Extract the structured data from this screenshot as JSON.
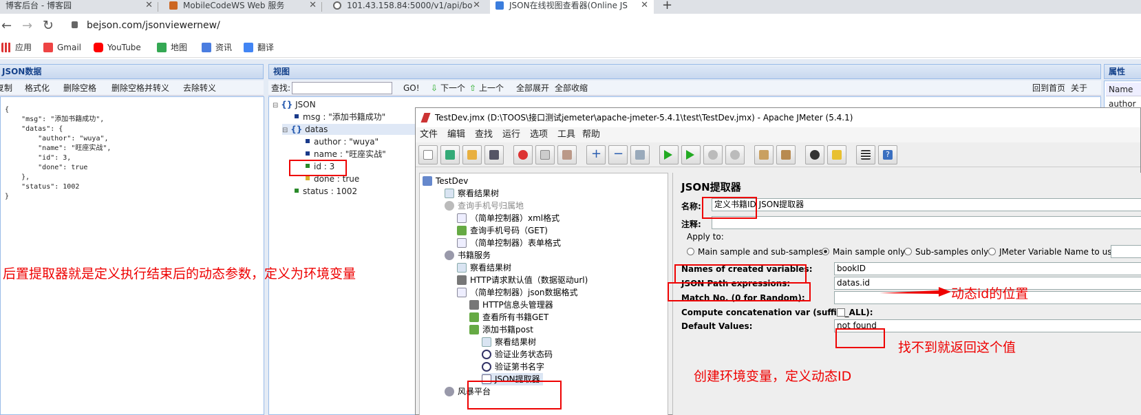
{
  "browser": {
    "tabs": [
      {
        "title": "博客后台 - 博客园",
        "active": false
      },
      {
        "title": "MobileCodeWS Web 服务",
        "active": false
      },
      {
        "title": "101.43.158.84:5000/v1/api/bo",
        "active": false
      },
      {
        "title": "JSON在线视图查看器(Online JS",
        "active": true
      }
    ],
    "new_tab": "+",
    "url": "bejson.com/jsonviewernew/",
    "bookmarks": [
      "应用",
      "Gmail",
      "YouTube",
      "地图",
      "资讯",
      "翻译"
    ]
  },
  "bejson": {
    "left_header": "JSON数据",
    "left_toolbar": [
      "复制",
      "格式化",
      "删除空格",
      "删除空格并转义",
      "去除转义"
    ],
    "json_text": "{\n    \"msg\": \"添加书籍成功\",\n    \"datas\": {\n        \"author\": \"wuya\",\n        \"name\": \"旺座实战\",\n        \"id\": 3,\n        \"done\": true\n    },\n    \"status\": 1002\n}",
    "view_header": "视图",
    "search_label": "查找:",
    "go_label": "GO!",
    "next_label": "下一个",
    "prev_label": "上一个",
    "expand_all": "全部展开",
    "collapse_all": "全部收缩",
    "home_label": "回到首页",
    "about_label": "关于",
    "attr_header": "属性",
    "attr_col": "Name",
    "attr_row": "author",
    "tree": [
      "JSON",
      "msg : \"添加书籍成功\"",
      "datas",
      "author : \"wuya\"",
      "name : \"旺座实战\"",
      "id : 3",
      "done : true",
      "status : 1002"
    ]
  },
  "annotations": {
    "left_note": "后置提取器就是定义执行结束后的动态参数，定义为环境变量",
    "path_note": "动态id的位置",
    "default_note": "找不到就返回这个值",
    "create_note": "创建环境变量，定义动态ID"
  },
  "jmeter": {
    "title": "TestDev.jmx (D:\\TOOS\\接口测试jemeter\\apache-jmeter-5.4.1\\test\\TestDev.jmx) - Apache JMeter (5.4.1)",
    "menu": [
      "文件",
      "编辑",
      "查找",
      "运行",
      "选项",
      "工具",
      "帮助"
    ],
    "tree": [
      {
        "label": "TestDev",
        "dim": false
      },
      {
        "label": "察看结果树",
        "dim": false
      },
      {
        "label": "查询手机号归属地",
        "dim": true
      },
      {
        "label": "（简单控制器）xml格式",
        "dim": false
      },
      {
        "label": "查询手机号码（GET)",
        "dim": false
      },
      {
        "label": "（简单控制器）表单格式",
        "dim": false
      },
      {
        "label": "书籍服务",
        "dim": false
      },
      {
        "label": "察看结果树",
        "dim": false
      },
      {
        "label": "HTTP请求默认值（数据驱动url)",
        "dim": false
      },
      {
        "label": "（简单控制器）json数据格式",
        "dim": false
      },
      {
        "label": "HTTP信息头管理器",
        "dim": false
      },
      {
        "label": "查看所有书籍GET",
        "dim": false
      },
      {
        "label": "添加书籍post",
        "dim": false
      },
      {
        "label": "察看结果树",
        "dim": false
      },
      {
        "label": "验证业务状态码",
        "dim": false
      },
      {
        "label": "验证第书名字",
        "dim": false
      },
      {
        "label": "JSON提取器",
        "dim": false
      },
      {
        "label": "风暴平台",
        "dim": false
      }
    ],
    "form": {
      "heading": "JSON提取器",
      "name_label": "名称:",
      "name_value": "定义书籍ID JSON提取器",
      "comment_label": "注释:",
      "comment_value": "",
      "apply_to": "Apply to:",
      "radios": [
        "Main sample and sub-samples",
        "Main sample only",
        "Sub-samples only",
        "JMeter Variable Name to use"
      ],
      "radio_selected": "Main sample only",
      "var_label": "Names of created variables:",
      "var_value": "bookID",
      "path_label": "JSON Path expressions:",
      "path_value": "datas.id",
      "match_label": "Match No. (0 for Random):",
      "match_value": "",
      "concat_label": "Compute concatenation var (suffix _ALL):",
      "default_label": "Default Values:",
      "default_value": "not found"
    }
  }
}
